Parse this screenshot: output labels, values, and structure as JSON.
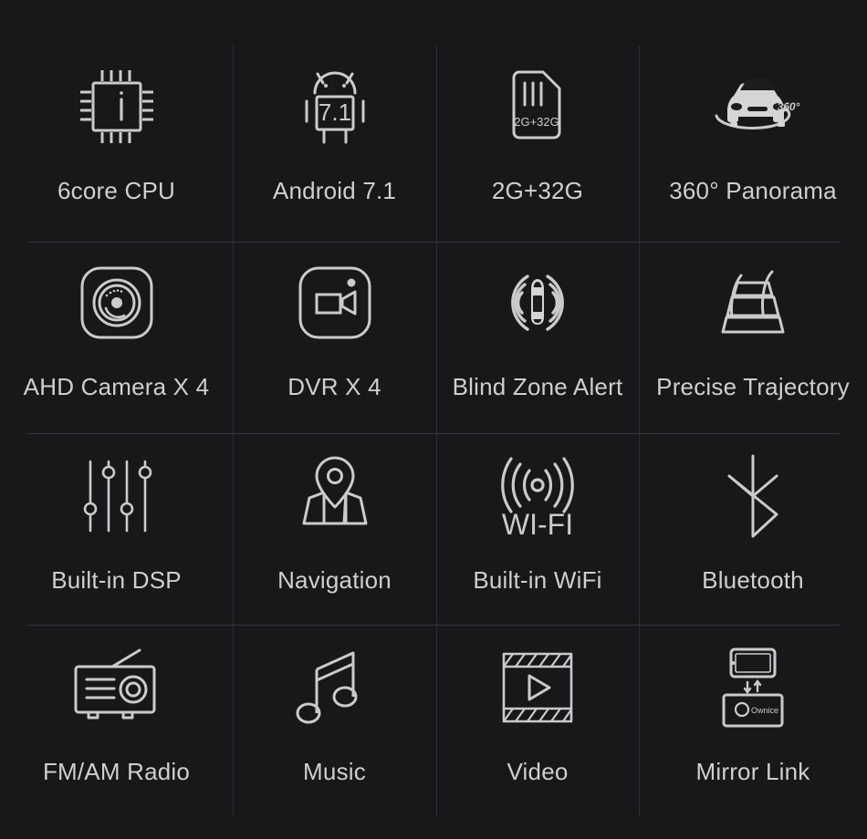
{
  "page": {
    "background_color": "#16181a",
    "label_color": "#cfcfcf",
    "icon_color": "#c9cbcd",
    "divider_color": "#33363a",
    "columns": 4,
    "rows": 4
  },
  "features": [
    {
      "id": "6core-cpu",
      "label": "6core CPU",
      "icon": "cpu-chip-icon",
      "icon_text": ""
    },
    {
      "id": "android-71",
      "label": "Android 7.1",
      "icon": "android-robot-icon",
      "icon_text": "7.1"
    },
    {
      "id": "2g-32g",
      "label": "2G+32G",
      "icon": "memory-card-icon",
      "icon_text": "2G+32G"
    },
    {
      "id": "360-panorama",
      "label": "360° Panorama",
      "icon": "car-360-view-icon",
      "icon_text": "360°"
    },
    {
      "id": "ahd-camera-x4",
      "label": "AHD Camera X 4",
      "icon": "camera-lens-icon",
      "icon_text": ""
    },
    {
      "id": "dvr-x4",
      "label": "DVR X 4",
      "icon": "video-recorder-icon",
      "icon_text": ""
    },
    {
      "id": "blind-zone-alert",
      "label": "Blind Zone Alert",
      "icon": "blind-zone-radar-icon",
      "icon_text": ""
    },
    {
      "id": "precise-trajectory",
      "label": "Precise Trajectory",
      "icon": "parking-guideline-icon",
      "icon_text": ""
    },
    {
      "id": "built-in-dsp",
      "label": "Built-in DSP",
      "icon": "equalizer-slider-icon",
      "icon_text": ""
    },
    {
      "id": "navigation",
      "label": "Navigation",
      "icon": "map-pin-icon",
      "icon_text": ""
    },
    {
      "id": "built-in-wifi",
      "label": "Built-in WiFi",
      "icon": "wifi-signal-icon",
      "icon_text": "WI-FI"
    },
    {
      "id": "bluetooth",
      "label": "Bluetooth",
      "icon": "bluetooth-icon",
      "icon_text": ""
    },
    {
      "id": "fm-am-radio",
      "label": "FM/AM Radio",
      "icon": "radio-icon",
      "icon_text": ""
    },
    {
      "id": "music",
      "label": "Music",
      "icon": "music-note-icon",
      "icon_text": ""
    },
    {
      "id": "video",
      "label": "Video",
      "icon": "film-play-icon",
      "icon_text": ""
    },
    {
      "id": "mirror-link",
      "label": "Mirror Link",
      "icon": "mirror-link-icon",
      "icon_text": "Ownice"
    }
  ]
}
